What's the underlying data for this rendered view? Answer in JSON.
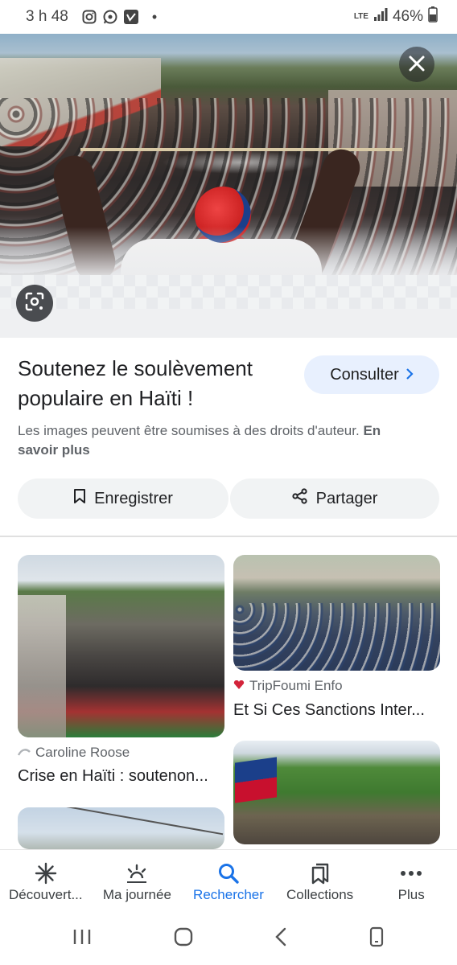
{
  "status_bar": {
    "time": "3 h 48",
    "network": "LTE",
    "battery": "46%",
    "icons": [
      "instagram-icon",
      "whatsapp-icon",
      "vimeo-icon"
    ]
  },
  "image_viewer": {
    "close_icon": "close-icon",
    "lens_icon": "lens-icon",
    "title": "Soutenez le soulèvement populaire en Haïti !",
    "consult_label": "Consulter",
    "copyright_text": "Les images peuvent être soumises à des droits d'auteur.",
    "learn_more": "En savoir plus",
    "save_label": "Enregistrer",
    "share_label": "Partager"
  },
  "related": [
    {
      "source": "Caroline Roose",
      "title": "Crise en Haïti : soutenon..."
    },
    {
      "source": "TripFoumi Enfo",
      "title": "Et Si Ces Sanctions Inter..."
    }
  ],
  "bottom_nav": {
    "items": [
      {
        "label": "Découvert...",
        "icon": "asterisk-icon"
      },
      {
        "label": "Ma journée",
        "icon": "sunrise-icon"
      },
      {
        "label": "Rechercher",
        "icon": "search-icon"
      },
      {
        "label": "Collections",
        "icon": "bookmark-stack-icon"
      },
      {
        "label": "Plus",
        "icon": "more-dots-icon"
      }
    ],
    "active_label": "Rechercher"
  },
  "colors": {
    "accent": "#1a73e8",
    "button_bg": "#e8f0fe",
    "chip_bg": "#f1f3f4"
  }
}
